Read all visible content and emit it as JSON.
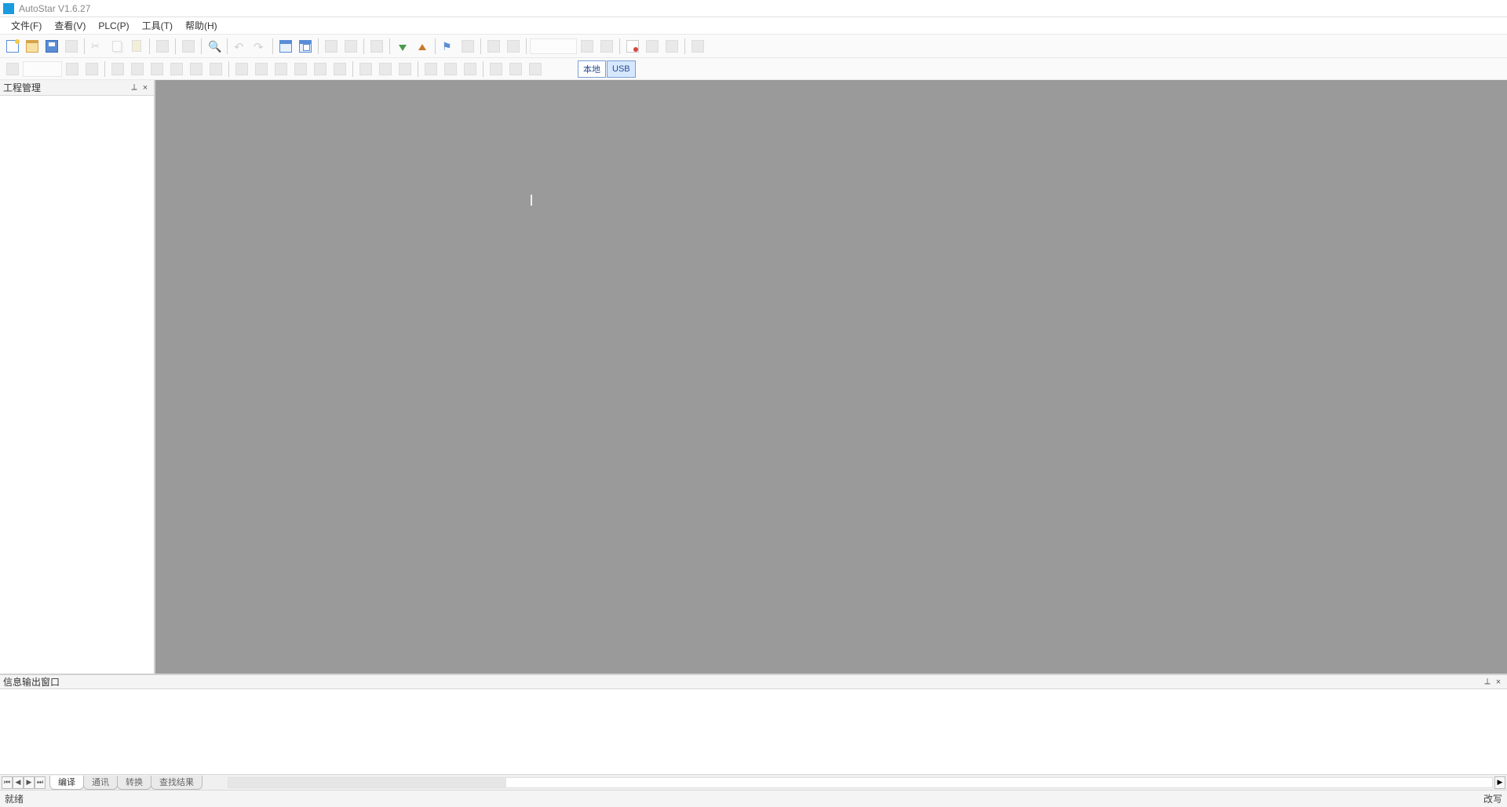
{
  "window": {
    "title": "AutoStar V1.6.27"
  },
  "menu": {
    "file": "文件(F)",
    "view": "查看(V)",
    "plc": "PLC(P)",
    "tool": "工具(T)",
    "help": "帮助(H)"
  },
  "toolbar1": {
    "new": "new",
    "open": "open",
    "save": "save",
    "cut": "cut",
    "copy": "copy",
    "paste": "paste",
    "search": "search",
    "undo": "undo",
    "redo": "redo"
  },
  "toolbar2": {
    "conn_label": "本地",
    "usb_label": "USB"
  },
  "side_panel": {
    "title": "工程管理"
  },
  "output_panel": {
    "title": "信息输出窗口",
    "tabs": {
      "t1": "编译",
      "t2": "通讯",
      "t3": "转换",
      "t4": "查找结果"
    }
  },
  "status": {
    "left": "就绪",
    "right": "改写"
  }
}
